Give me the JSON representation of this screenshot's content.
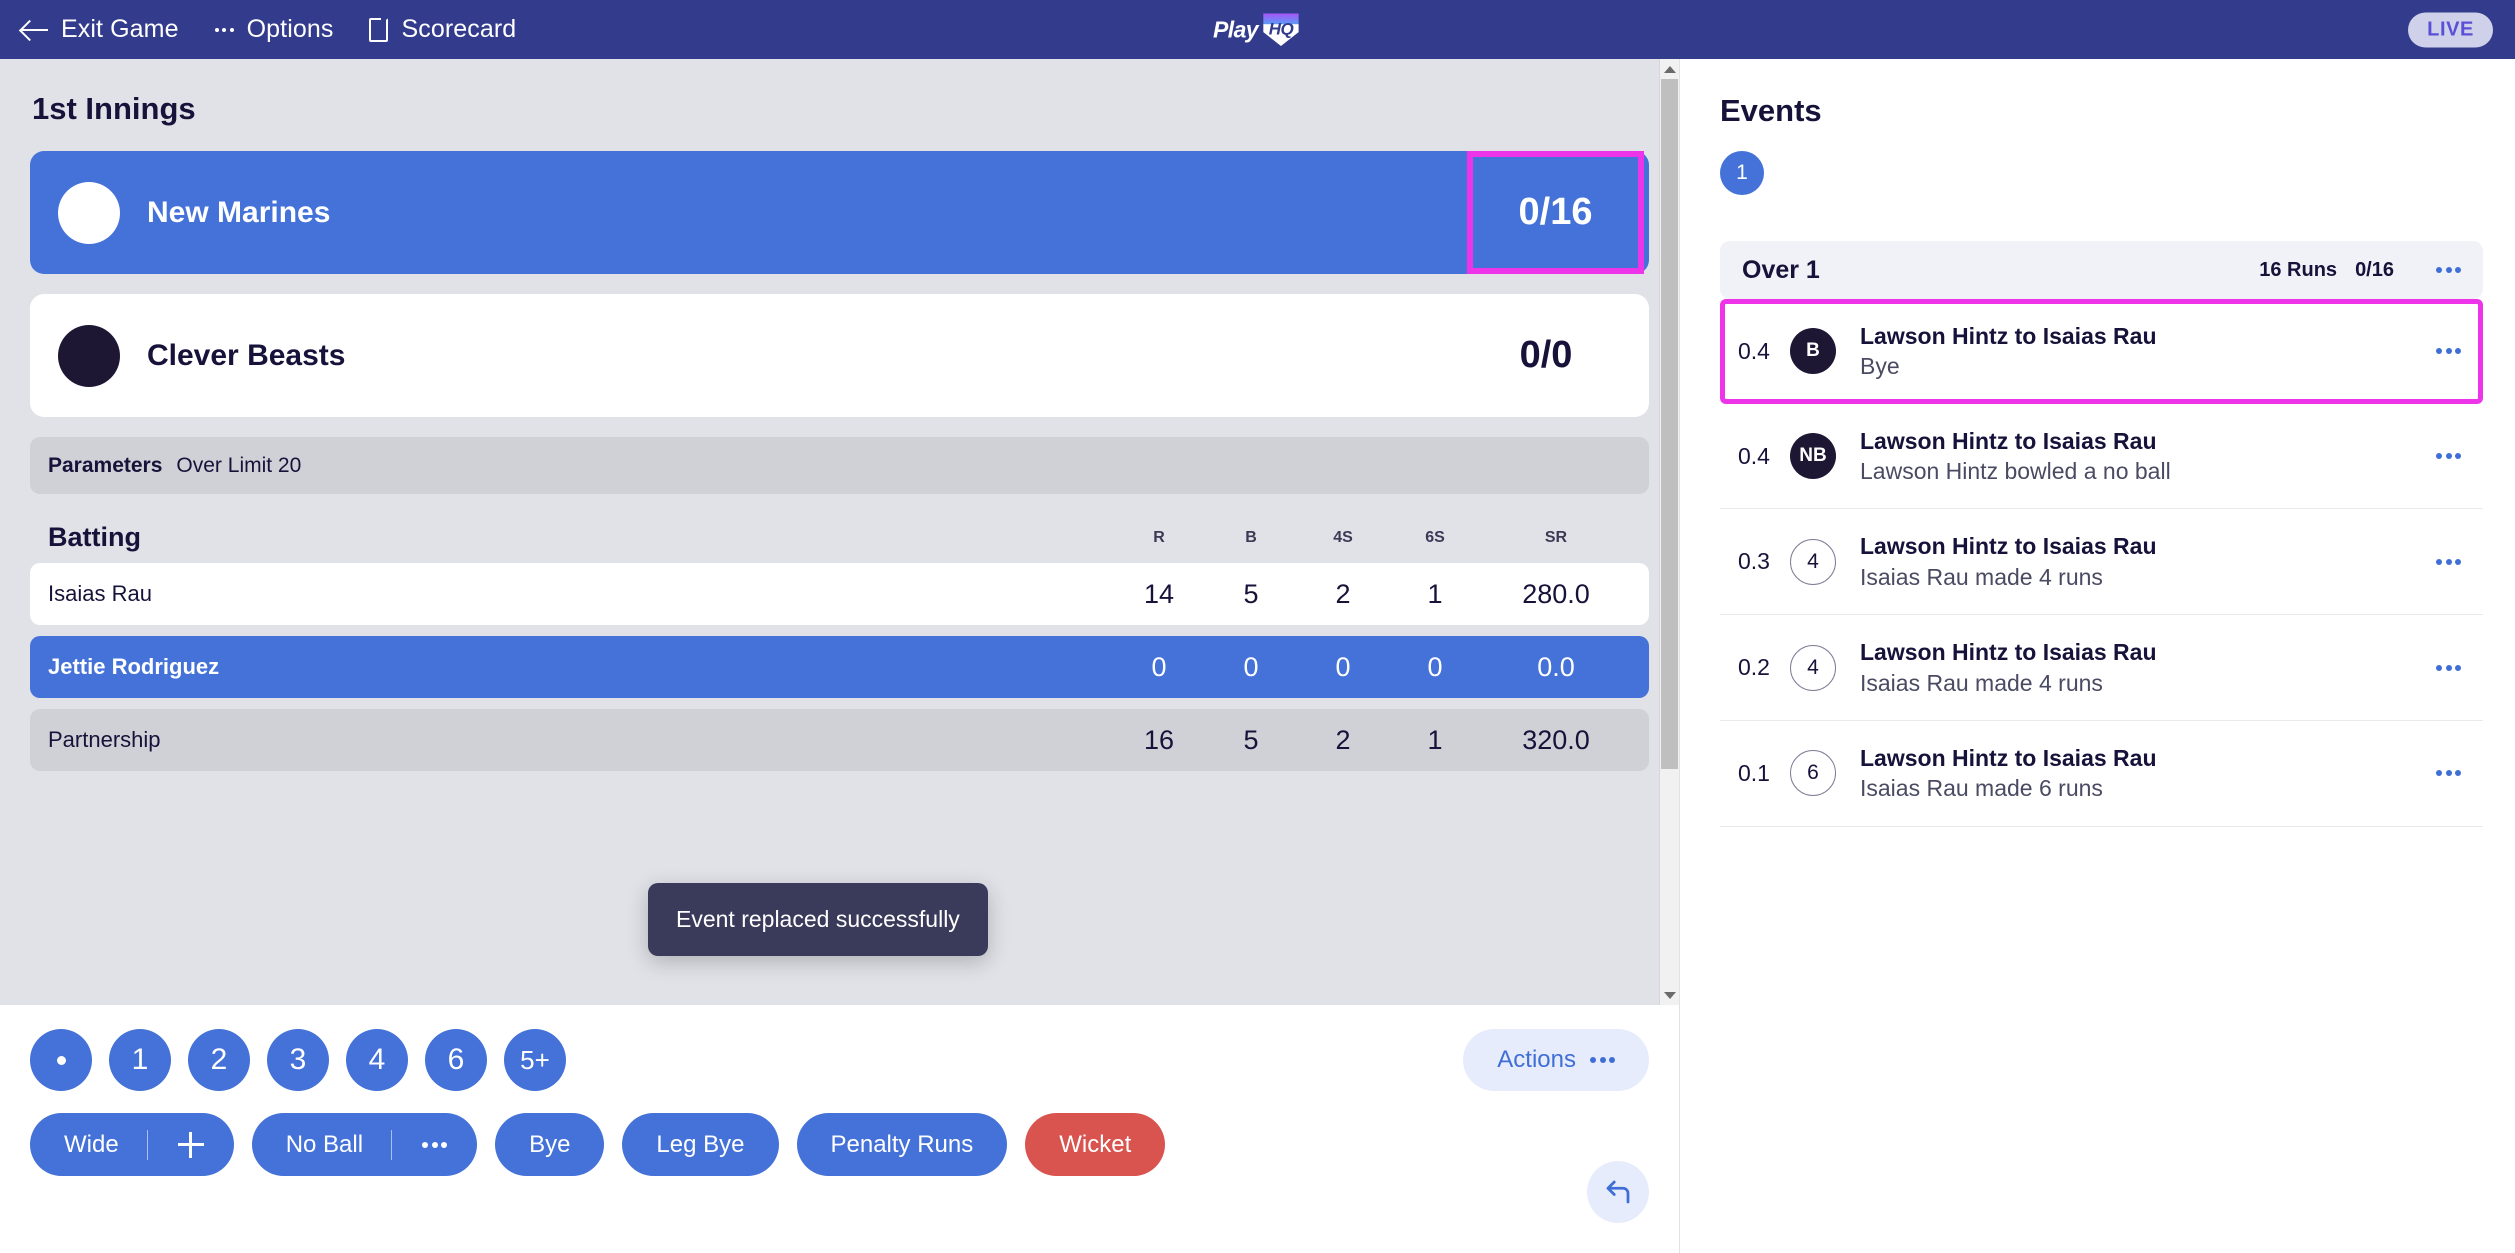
{
  "topbar": {
    "exit_label": "Exit Game",
    "options_label": "Options",
    "scorecard_label": "Scorecard",
    "logo_play": "Play",
    "logo_hq": "HQ",
    "live_label": "LIVE",
    "bg_color": "#333b8c"
  },
  "innings": {
    "title": "1st Innings",
    "teams": [
      {
        "name": "New Marines",
        "score": "0/16",
        "active": true,
        "logo": "light",
        "highlighted": true
      },
      {
        "name": "Clever Beasts",
        "score": "0/0",
        "active": false,
        "logo": "dark",
        "highlighted": false
      }
    ]
  },
  "parameters": {
    "label": "Parameters",
    "value": "Over Limit 20"
  },
  "batting": {
    "heading": "Batting",
    "columns": [
      "R",
      "B",
      "4S",
      "6S",
      "SR"
    ],
    "rows": [
      {
        "name": "Isaias Rau",
        "r": "14",
        "b": "5",
        "fours": "2",
        "sixes": "1",
        "sr": "280.0",
        "style": "white"
      },
      {
        "name": "Jettie Rodriguez",
        "r": "0",
        "b": "0",
        "fours": "0",
        "sixes": "0",
        "sr": "0.0",
        "style": "blue"
      },
      {
        "name": "Partnership",
        "r": "16",
        "b": "5",
        "fours": "2",
        "sixes": "1",
        "sr": "320.0",
        "style": "grey"
      }
    ]
  },
  "toast": {
    "message": "Event replaced successfully"
  },
  "controls": {
    "runs": [
      {
        "label": "",
        "kind": "dot"
      },
      {
        "label": "1",
        "kind": "num"
      },
      {
        "label": "2",
        "kind": "num"
      },
      {
        "label": "3",
        "kind": "num"
      },
      {
        "label": "4",
        "kind": "num"
      },
      {
        "label": "6",
        "kind": "num"
      },
      {
        "label": "5+",
        "kind": "plus"
      }
    ],
    "actions_label": "Actions",
    "wide_label": "Wide",
    "no_ball_label": "No Ball",
    "bye_label": "Bye",
    "leg_bye_label": "Leg Bye",
    "penalty_runs_label": "Penalty Runs",
    "wicket_label": "Wicket",
    "wicket_color": "#d9534f",
    "primary_color": "#4472d8"
  },
  "events": {
    "title": "Events",
    "over_tabs": [
      "1"
    ],
    "over_header": {
      "title": "Over 1",
      "runs": "16 Runs",
      "score": "0/16"
    },
    "list": [
      {
        "ball": "0.4",
        "badge": "B",
        "badge_style": "solid",
        "title": "Lawson Hintz to Isaias Rau",
        "sub": "Bye",
        "selected": true
      },
      {
        "ball": "0.4",
        "badge": "NB",
        "badge_style": "solid",
        "title": "Lawson Hintz to Isaias Rau",
        "sub": "Lawson Hintz bowled a no ball",
        "selected": false
      },
      {
        "ball": "0.3",
        "badge": "4",
        "badge_style": "hollow",
        "title": "Lawson Hintz to Isaias Rau",
        "sub": "Isaias Rau made 4 runs",
        "selected": false
      },
      {
        "ball": "0.2",
        "badge": "4",
        "badge_style": "hollow",
        "title": "Lawson Hintz to Isaias Rau",
        "sub": "Isaias Rau made 4 runs",
        "selected": false
      },
      {
        "ball": "0.1",
        "badge": "6",
        "badge_style": "hollow",
        "title": "Lawson Hintz to Isaias Rau",
        "sub": "Isaias Rau made 6 runs",
        "selected": false
      }
    ]
  }
}
